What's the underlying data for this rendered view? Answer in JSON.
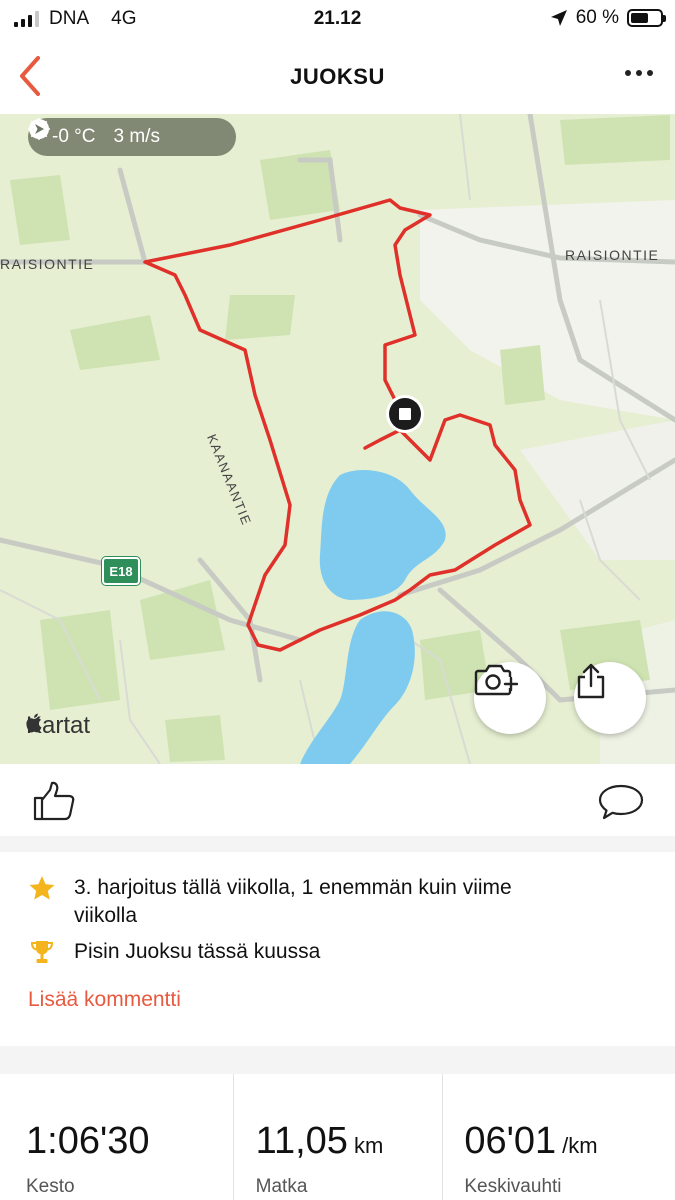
{
  "status_bar": {
    "carrier": "DNA",
    "network": "4G",
    "time": "21.12",
    "battery_percent": "60 %",
    "battery_level": 0.6
  },
  "nav": {
    "title": "JUOKSU",
    "back_icon": "chevron-left-icon",
    "more_icon": "more-horizontal-icon",
    "accent_color": "#e85a3f"
  },
  "map": {
    "weather": {
      "temperature": "-0 °C",
      "wind": "3 m/s"
    },
    "road_labels": {
      "raisiontie_left": "RAISIONTIE",
      "raisiontie_right": "RAISIONTIE",
      "kaanaantie": "KAANAANTIE",
      "e18": "E18"
    },
    "attribution": "Kartat",
    "route_color": "#e0302a",
    "water_color": "#7ecbef"
  },
  "actions": {
    "like_icon": "thumbs-up-icon",
    "comment_icon": "comment-icon"
  },
  "achievements": {
    "items": [
      {
        "icon": "star-icon",
        "text": "3. harjoitus tällä viikolla, 1 enemmän kuin viime viikolla"
      },
      {
        "icon": "trophy-icon",
        "text": "Pisin Juoksu tässä kuussa"
      }
    ],
    "add_comment": "Lisää kommentti"
  },
  "stats": [
    {
      "value": "1:06'30",
      "unit": "",
      "label": "Kesto"
    },
    {
      "value": "11,05",
      "unit": "km",
      "label": "Matka"
    },
    {
      "value": "06'01",
      "unit": "/km",
      "label": "Keskivauhti"
    }
  ]
}
